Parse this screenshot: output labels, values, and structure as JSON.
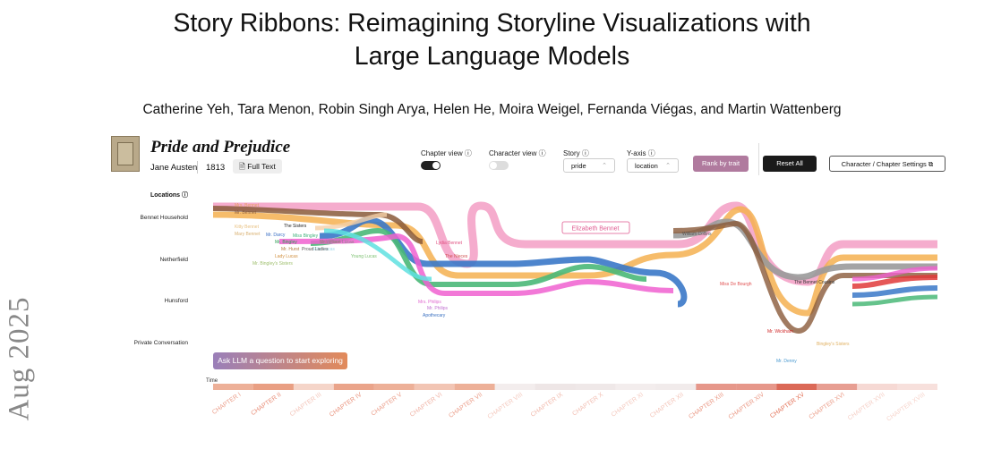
{
  "arxiv_stamp": "Aug 2025",
  "paper": {
    "title_line1": "Story Ribbons: Reimagining Storyline Visualizations with",
    "title_line2": "Large Language Models",
    "authors": "Catherine Yeh, Tara Menon, Robin Singh Arya, Helen He, Moira Weigel, Fernanda Viégas, and Martin Wattenberg"
  },
  "book": {
    "title": "Pride and Prejudice",
    "author": "Jane Austen",
    "year": "1813",
    "full_text_label": "Full Text"
  },
  "controls": {
    "chapter_view_label": "Chapter view ⓘ",
    "character_view_label": "Character view ⓘ",
    "story_label": "Story ⓘ",
    "story_value": "pride",
    "yaxis_label": "Y-axis ⓘ",
    "yaxis_value": "location",
    "rank_label": "Rank by trait",
    "reset_label": "Reset All",
    "settings_label": "Character / Chapter Settings"
  },
  "locations_header": "Locations ⓘ",
  "locations": [
    "Bennet Household",
    "Netherfield",
    "Hunsford",
    "Private Conversation"
  ],
  "ask_label": "Ask LLM a question to start exploring",
  "time_label": "Time",
  "tooltip": "Elizabeth Bennet",
  "chapters": [
    "CHAPTER I",
    "CHAPTER II",
    "CHAPTER III",
    "CHAPTER IV",
    "CHAPTER V",
    "CHAPTER VI",
    "CHAPTER VII",
    "CHAPTER VIII",
    "CHAPTER IX",
    "CHAPTER X",
    "CHAPTER XI",
    "CHAPTER XII",
    "CHAPTER XIII",
    "CHAPTER XIV",
    "CHAPTER XV",
    "CHAPTER XVI",
    "CHAPTER XVII",
    "CHAPTER XVIII"
  ],
  "chapter_intensity": [
    0.55,
    0.7,
    0.2,
    0.65,
    0.55,
    0.35,
    0.55,
    0.15,
    0.3,
    0.25,
    0.15,
    0.2,
    0.6,
    0.6,
    0.95,
    0.55,
    0.1,
    0.05
  ],
  "character_labels": [
    {
      "text": "Mrs. Bennet",
      "color": "#e4a060"
    },
    {
      "text": "Mr. Bennet",
      "color": "#8a5a3a"
    },
    {
      "text": "The Sisters",
      "color": "#222"
    },
    {
      "text": "Kitty Bennet",
      "color": "#e8c080"
    },
    {
      "text": "Mary Bennet",
      "color": "#d8b070"
    },
    {
      "text": "Mr. Darcy",
      "color": "#3a6fc4"
    },
    {
      "text": "Miss Bingley",
      "color": "#3fb07a"
    },
    {
      "text": "Ellis Lucas",
      "color": "#a0d8e8"
    },
    {
      "text": "Mr. Bingley",
      "color": "#2a9a50"
    },
    {
      "text": "Mrs. Hurst",
      "color": "#c07080"
    },
    {
      "text": "Sir William Lucas",
      "color": "#888"
    },
    {
      "text": "Mr. Hurst",
      "color": "#b07a40"
    },
    {
      "text": "Proud Ladies",
      "color": "#555"
    },
    {
      "text": "Young Lucas",
      "color": "#7cc070"
    },
    {
      "text": "Lady Lucas",
      "color": "#d09040"
    },
    {
      "text": "Mr. Bingley's Sisters",
      "color": "#a0c070"
    },
    {
      "text": "Lydia Bennet",
      "color": "#e05080"
    },
    {
      "text": "The Nieces",
      "color": "#d05050"
    },
    {
      "text": "Mrs. Philips",
      "color": "#e06ad0"
    },
    {
      "text": "Mr. Philips",
      "color": "#c070d0"
    },
    {
      "text": "Apothecary",
      "color": "#3a70c0"
    },
    {
      "text": "William Collins",
      "color": "#555"
    },
    {
      "text": "Miss De Bourgh",
      "color": "#e05050"
    },
    {
      "text": "The Bennet Cousins",
      "color": "#333"
    },
    {
      "text": "Mr. Wickham",
      "color": "#d02828"
    },
    {
      "text": "Bingley's Sisters",
      "color": "#e0b060"
    },
    {
      "text": "Mr. Denny",
      "color": "#4a9ad0"
    }
  ]
}
